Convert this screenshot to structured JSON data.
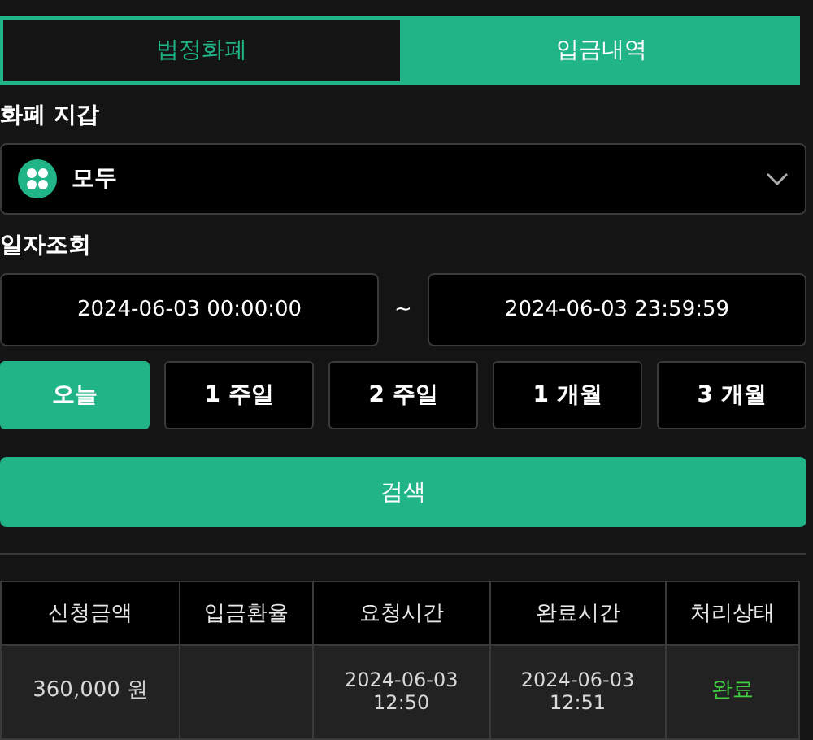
{
  "tabs": [
    {
      "label": "법정화폐",
      "selected": false
    },
    {
      "label": "입금내역",
      "selected": true
    }
  ],
  "wallet": {
    "label": "화폐 지갑",
    "value": "모두"
  },
  "date_query": {
    "label": "일자조회",
    "from": "2024-06-03 00:00:00",
    "separator": "~",
    "to": "2024-06-03 23:59:59"
  },
  "periods": [
    {
      "label": "오늘",
      "selected": true
    },
    {
      "label": "1 주일",
      "selected": false
    },
    {
      "label": "2 주일",
      "selected": false
    },
    {
      "label": "1 개월",
      "selected": false
    },
    {
      "label": "3 개월",
      "selected": false
    }
  ],
  "search_button": "검색",
  "table": {
    "columns": [
      "신청금액",
      "입금환율",
      "요청시간",
      "완료시간",
      "처리상태"
    ],
    "rows": [
      {
        "cells": [
          {
            "kind": "text",
            "lines": [
              "360,000 원"
            ]
          },
          {
            "kind": "empty"
          },
          {
            "kind": "text",
            "lines": [
              "2024-06-03",
              "12:50"
            ]
          },
          {
            "kind": "text",
            "lines": [
              "2024-06-03",
              "12:51"
            ]
          },
          {
            "kind": "status",
            "lines": [
              "완료"
            ]
          }
        ]
      }
    ]
  }
}
